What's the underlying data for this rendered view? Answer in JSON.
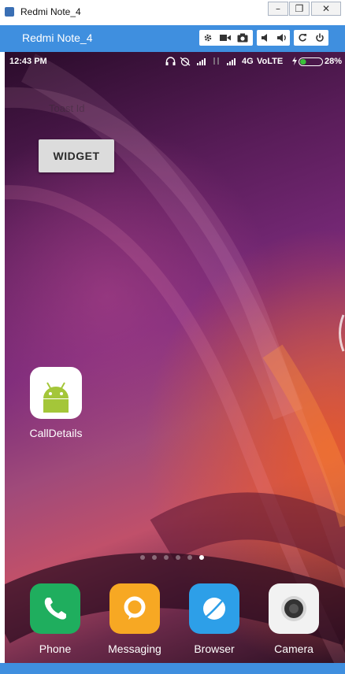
{
  "window": {
    "title": "Redmi Note_4"
  },
  "vysor": {
    "title": "Redmi Note_4"
  },
  "status_bar": {
    "time": "12:43 PM",
    "network": "4G",
    "volte": "VoLTE",
    "battery": "28%"
  },
  "home": {
    "faded_text": "Toast Id",
    "widget_button": "WIDGET",
    "app_icon_label": "CallDetails",
    "page_indicator": {
      "count": 6,
      "active": 6
    },
    "dock": [
      {
        "label": "Phone"
      },
      {
        "label": "Messaging"
      },
      {
        "label": "Browser"
      },
      {
        "label": "Camera"
      }
    ]
  },
  "colors": {
    "accent": "#3f8fdf",
    "phone_app": "#1fae5e",
    "messaging_app": "#f7a823",
    "browser_app": "#2d9fe8",
    "android_green": "#a4c639"
  }
}
